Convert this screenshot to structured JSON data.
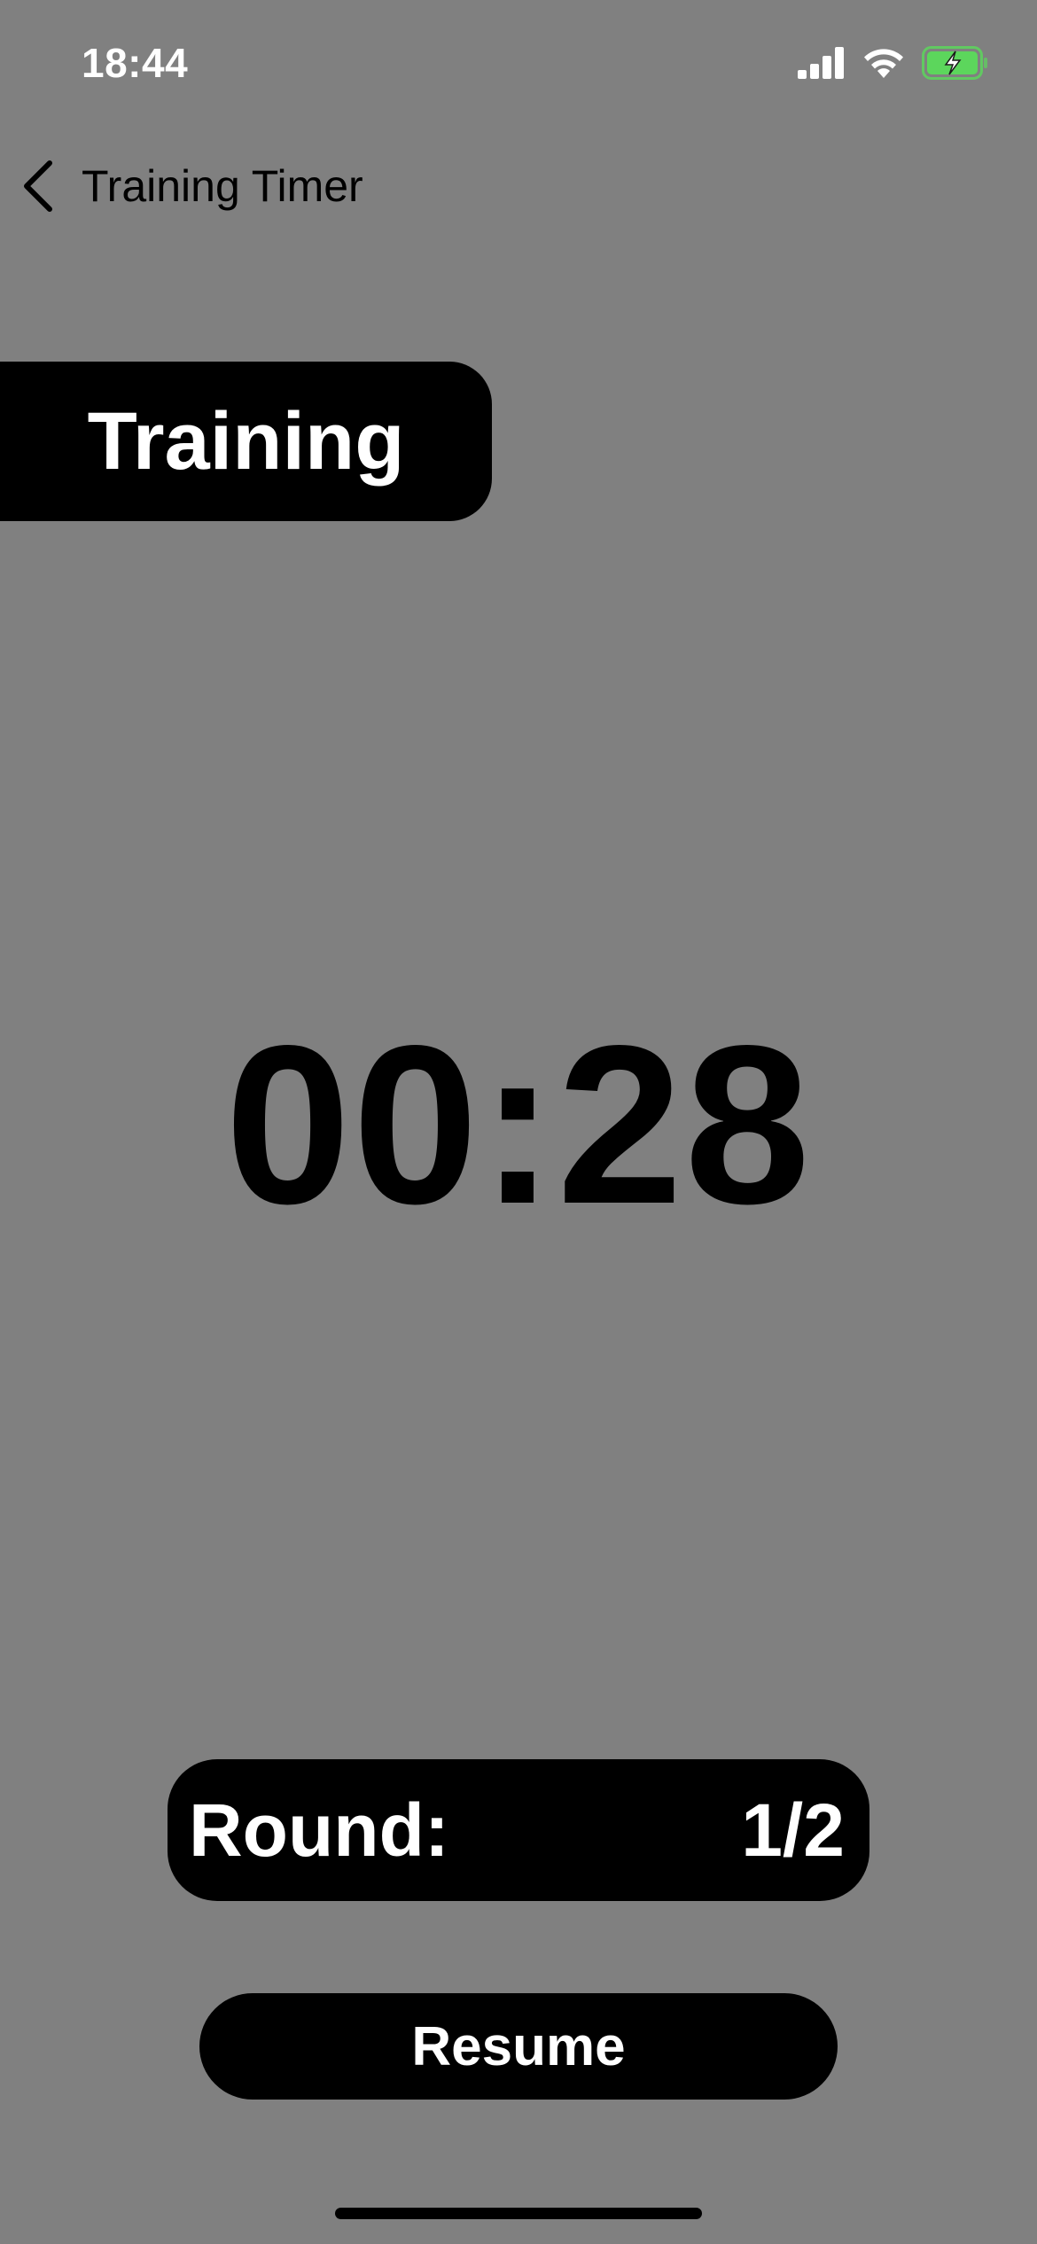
{
  "status_bar": {
    "time": "18:44",
    "icons": [
      "cellular-signal-icon",
      "wifi-icon",
      "battery-charging-icon"
    ],
    "battery_color": "#5CD65C"
  },
  "nav": {
    "back_label": "Training Timer",
    "back_icon": "chevron-left-icon"
  },
  "phase": {
    "label": "Training"
  },
  "timer": {
    "value": "00:28"
  },
  "round": {
    "label": "Round:",
    "value": "1/2"
  },
  "actions": {
    "resume_label": "Resume"
  },
  "colors": {
    "background": "#808080",
    "panel": "#000000",
    "panel_text": "#FFFFFF"
  }
}
